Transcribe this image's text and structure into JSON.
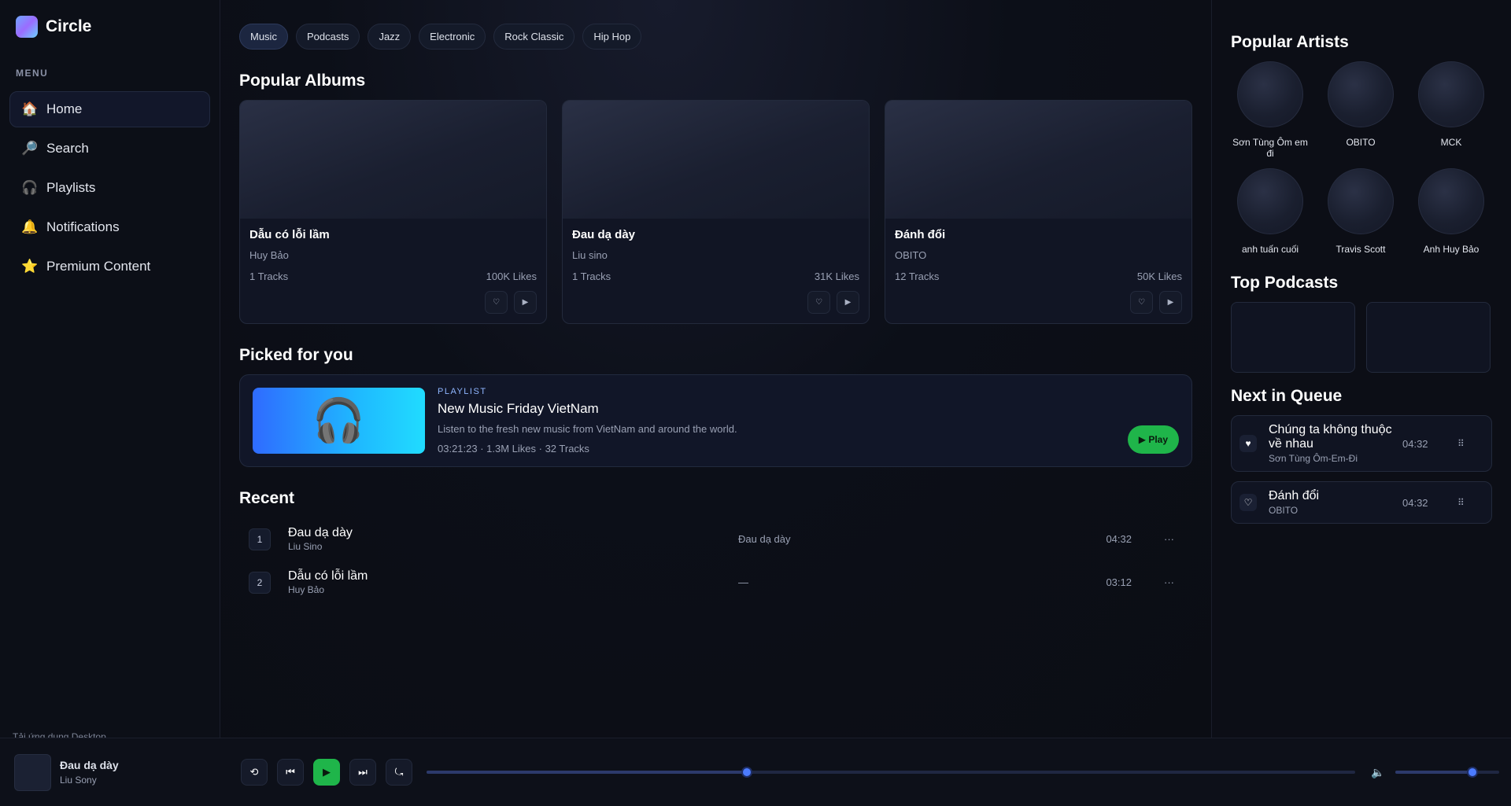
{
  "app": {
    "name": "Circle"
  },
  "sidebar": {
    "menu_label": "MENU",
    "items": [
      {
        "label": "Home",
        "icon": "🏠"
      },
      {
        "label": "Search",
        "icon": "🔎"
      },
      {
        "label": "Playlists",
        "icon": "🎧"
      },
      {
        "label": "Notifications",
        "icon": "🔔"
      },
      {
        "label": "Premium Content",
        "icon": "⭐"
      }
    ],
    "footer": "Tải ứng dụng Desktop"
  },
  "chips": [
    "Music",
    "Podcasts",
    "Jazz",
    "Electronic",
    "Rock Classic",
    "Hip Hop"
  ],
  "popular_albums": {
    "title": "Popular Albums",
    "items": [
      {
        "title": "Dẫu có lỗi lầm",
        "artist": "Huy Bảo",
        "tracks": "1 Tracks",
        "likes": "100K Likes"
      },
      {
        "title": "Đau dạ dày",
        "artist": "Liu sino",
        "tracks": "1 Tracks",
        "likes": "31K Likes"
      },
      {
        "title": "Đánh đổi",
        "artist": "OBITO",
        "tracks": "12 Tracks",
        "likes": "50K Likes"
      }
    ]
  },
  "picked": {
    "title": "Picked for you",
    "kind": "PLAYLIST",
    "playlist_title": "New Music Friday VietNam",
    "description": "Listen to the fresh new music from VietNam and around the world.",
    "meta": "03:21:23 · 1.3M Likes · 32 Tracks",
    "play_label": "▶ Play",
    "cover_icon": "🎧"
  },
  "recent": {
    "title": "Recent",
    "rows": [
      {
        "index": "1",
        "title": "Đau dạ dày",
        "artist": "Liu Sino",
        "album": "Đau dạ dày",
        "time": "04:32",
        "more": "···"
      },
      {
        "index": "2",
        "title": "Dẫu có lỗi lầm",
        "artist": "Huy Bảo",
        "album": "—",
        "time": "03:12",
        "more": "···"
      }
    ]
  },
  "artists": {
    "title": "Popular Artists",
    "items": [
      {
        "name": "Sơn Tùng Ôm em đi"
      },
      {
        "name": "OBITO"
      },
      {
        "name": "MCK"
      },
      {
        "name": "anh tuấn cuối"
      },
      {
        "name": "Travis Scott"
      },
      {
        "name": "Anh Huy Bảo"
      }
    ]
  },
  "podcasts": {
    "title": "Top Podcasts"
  },
  "queue": {
    "title": "Next in Queue",
    "items": [
      {
        "title": "Chúng ta không thuộc về nhau",
        "artist": "Sơn Tùng Ôm-Em-Đi",
        "time": "04:32",
        "icon": "♥",
        "drag": "⠿"
      },
      {
        "title": "Đánh đổi",
        "artist": "OBITO",
        "time": "04:32",
        "icon": "♡",
        "drag": "⠿"
      }
    ]
  },
  "player": {
    "title": "Đau dạ dày",
    "artist": "Liu Sony",
    "shuffle_icon": "⟲",
    "prev_icon": "⏮",
    "play_icon": "▶",
    "next_icon": "⏭",
    "repeat_icon": "⤿",
    "volume_icon": "🔈",
    "progress": 0.345,
    "volume": 0.74
  },
  "colors": {
    "accent": "#1fb54a",
    "knob": "#4b7bff",
    "background": "#0b0d14"
  }
}
